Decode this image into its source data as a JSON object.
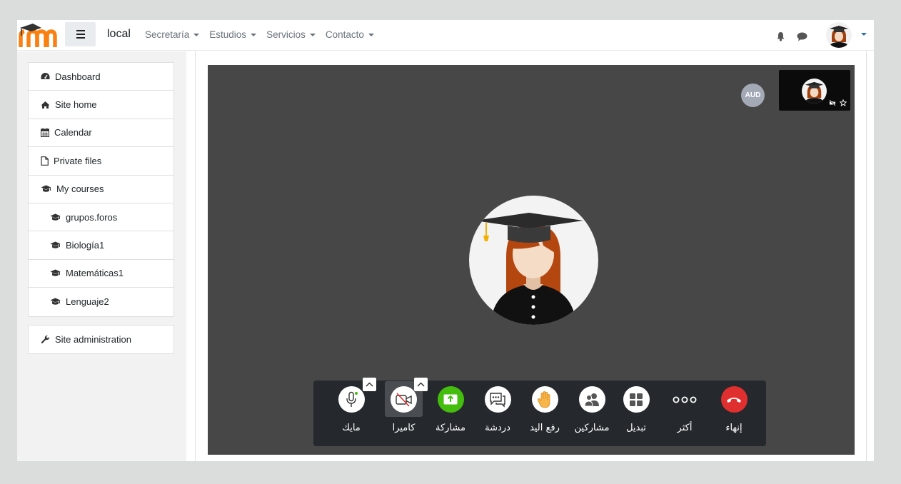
{
  "navbar": {
    "brand": "local",
    "menu": [
      "Secretaría",
      "Estudios",
      "Servicios",
      "Contacto"
    ]
  },
  "sidebar": {
    "items": [
      {
        "label": "Dashboard",
        "icon": "dashboard-icon"
      },
      {
        "label": "Site home",
        "icon": "home-icon"
      },
      {
        "label": "Calendar",
        "icon": "calendar-icon"
      },
      {
        "label": "Private files",
        "icon": "file-icon"
      },
      {
        "label": "My courses",
        "icon": "graduation-cap-icon"
      },
      {
        "label": "grupos.foros",
        "icon": "graduation-cap-icon"
      },
      {
        "label": "Biología1",
        "icon": "graduation-cap-icon"
      },
      {
        "label": "Matemáticas1",
        "icon": "graduation-cap-icon"
      },
      {
        "label": "Lenguaje2",
        "icon": "graduation-cap-icon"
      }
    ],
    "admin": {
      "label": "Site administration",
      "icon": "wrench-icon"
    }
  },
  "meeting": {
    "audio_badge": "AUD",
    "toolbar": [
      {
        "label": "مايك",
        "icon": "microphone-icon"
      },
      {
        "label": "كاميرا",
        "icon": "camera-off-icon"
      },
      {
        "label": "مشاركة",
        "icon": "share-screen-icon"
      },
      {
        "label": "دردشة",
        "icon": "chat-icon"
      },
      {
        "label": "رفع اليد",
        "icon": "raise-hand-icon"
      },
      {
        "label": "مشاركين",
        "icon": "participants-icon"
      },
      {
        "label": "تبديل",
        "icon": "tile-view-icon"
      },
      {
        "label": "أكثر",
        "icon": "more-icon"
      },
      {
        "label": "إنهاء",
        "icon": "hangup-icon"
      }
    ],
    "colors": {
      "share": "#44bd0e",
      "hangup": "#e02f2f",
      "stage": "#474747",
      "toolbar": "#25292e"
    }
  }
}
